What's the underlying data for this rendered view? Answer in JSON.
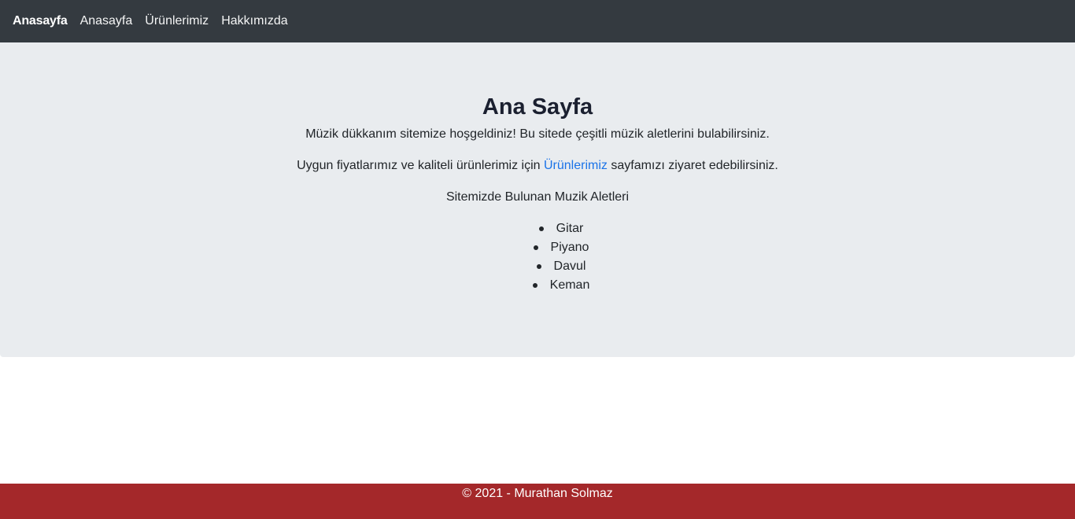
{
  "navbar": {
    "brand": "Anasayfa",
    "links": [
      "Anasayfa",
      "Ürünlerimiz",
      "Hakkımızda"
    ]
  },
  "main": {
    "title": "Ana Sayfa",
    "welcome": "Müzik dükkanım sitemize hoşgeldiniz! Bu sitede çeşitli müzik aletlerini bulabilirsiniz.",
    "products_pre": "Uygun fiyatlarımız ve kaliteli ürünlerimiz için ",
    "products_link": "Ürünlerimiz",
    "products_post": " sayfamızı ziyaret edebilirsiniz.",
    "list_heading": "Sitemizde Bulunan Muzik Aletleri",
    "instruments": [
      "Gitar",
      "Piyano",
      "Davul",
      "Keman"
    ]
  },
  "footer": {
    "text": "© 2021 - Murathan Solmaz"
  },
  "colors": {
    "navbar_bg": "#343a40",
    "jumbotron_bg": "#e9ecef",
    "link": "#1a73e8",
    "footer_bg": "#a4282a"
  }
}
